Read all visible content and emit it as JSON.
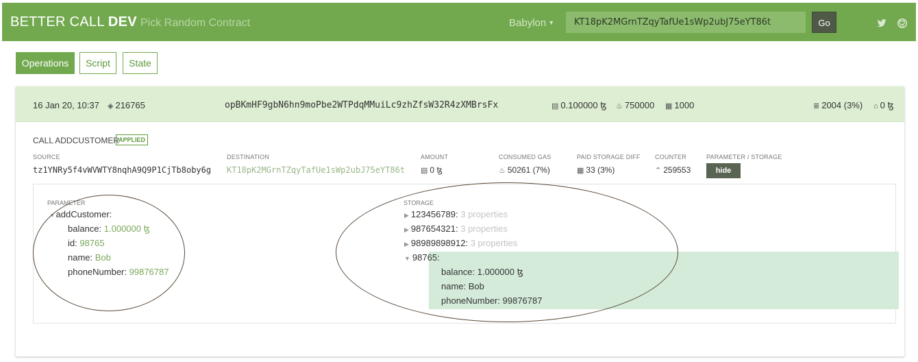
{
  "header": {
    "brand_light": "BETTER CALL ",
    "brand_bold": "DEV",
    "random_link": "Pick Random Contract",
    "network": "Babylon",
    "search_value": "KT18pK2MGrnTZqyTafUe1sWp2ubJ75eYT86t",
    "go_label": "Go"
  },
  "tabs": [
    {
      "label": "Operations",
      "active": true
    },
    {
      "label": "Script",
      "active": false
    },
    {
      "label": "State",
      "active": false
    }
  ],
  "operation": {
    "timestamp": "16 Jan 20, 10:37",
    "level": "216765",
    "hash": "opBKmHF9gbN6hn9moPbe2WTPdqMMuiLc9zhZfsW32R4zXMBrsFx",
    "fee": "0.100000 ꜩ",
    "gas_limit": "750000",
    "storage_limit": "1000",
    "storage_size": "2004 (3%)",
    "burned": "0 ꜩ"
  },
  "call": {
    "title": "CALL ADDCUSTOMER",
    "status": "APPLIED",
    "labels": {
      "source": "SOURCE",
      "destination": "DESTINATION",
      "amount": "AMOUNT",
      "consumed_gas": "CONSUMED GAS",
      "paid_storage": "PAID STORAGE DIFF",
      "counter": "COUNTER",
      "param_storage": "PARAMETER / STORAGE"
    },
    "source": "tz1YNRy5f4vWVWTY8nqhA9Q9P1CjTb8oby6g",
    "destination": "KT18pK2MGrnTZqyTafUe1sWp2ubJ75eYT86t",
    "amount": "0 ꜩ",
    "consumed_gas": "50261 (7%)",
    "paid_storage": "33 (3%)",
    "counter": "259553",
    "hide_label": "hide"
  },
  "parameter": {
    "label": "PARAMETER",
    "entry": "addCustomer:",
    "fields": [
      {
        "key": "balance: ",
        "value": "1.000000 ꜩ"
      },
      {
        "key": "id: ",
        "value": "98765"
      },
      {
        "key": "name: ",
        "value": "Bob"
      },
      {
        "key": "phoneNumber: ",
        "value": "99876787"
      }
    ]
  },
  "storage": {
    "label": "STORAGE",
    "collapsed": [
      {
        "key": "123456789:",
        "value": " 3 properties"
      },
      {
        "key": "987654321:",
        "value": " 3 properties"
      },
      {
        "key": "98989898912:",
        "value": " 3 properties"
      }
    ],
    "expanded_key": "98765:",
    "expanded_fields": [
      {
        "key": "balance: ",
        "value": "1.000000 ꜩ"
      },
      {
        "key": "name: ",
        "value": "Bob"
      },
      {
        "key": "phoneNumber: ",
        "value": "99876787"
      }
    ]
  },
  "colors": {
    "header_green": "#72a94f",
    "summary_bg": "#ddeed2",
    "highlight_bg": "#d4ebd9",
    "value_green": "#7aa85a"
  }
}
